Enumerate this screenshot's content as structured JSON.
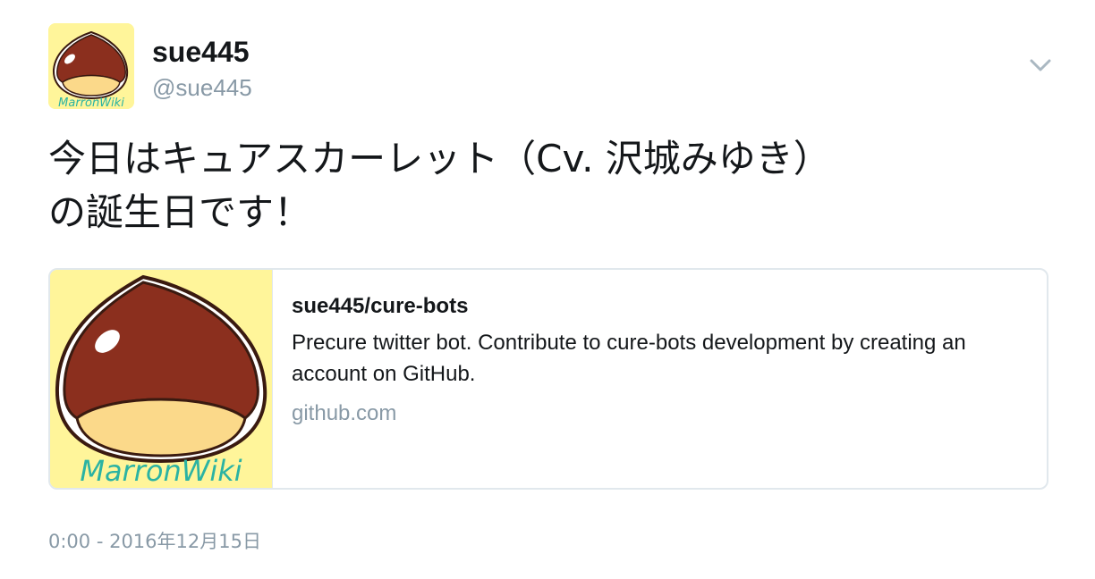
{
  "user": {
    "display_name": "sue445",
    "handle": "@sue445",
    "avatar_logo_text": "MarronWiki"
  },
  "tweet": {
    "text": "今日はキュアスカーレット（Cv. 沢城みゆき）\nの誕生日です！",
    "timestamp": "0:00 - 2016年12月15日"
  },
  "card": {
    "title": "sue445/cure-bots",
    "description": "Precure twitter bot. Contribute to cure-bots development by creating an account on GitHub.",
    "domain": "github.com",
    "image_logo_text": "MarronWiki"
  },
  "icons": {
    "menu": "chevron-down-icon"
  },
  "colors": {
    "text": "#14171a",
    "secondary": "#8899a6",
    "border": "#e1e8ed",
    "avatar_bg": "#fff59a",
    "chestnut_brown": "#8b2f1e",
    "chestnut_cream": "#fbd98a",
    "logo_green": "#2bb3a3"
  }
}
